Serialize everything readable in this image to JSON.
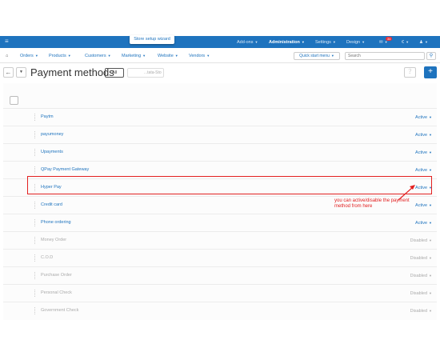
{
  "topbar": {
    "menu_icon": "hamburger-icon",
    "wizard_label": "Store setup wizard",
    "addons": "Add-ons",
    "administration": "Administration",
    "settings": "Settings",
    "design": "Design",
    "notifications_count": "34",
    "currency": "€",
    "user_icon": "user-icon"
  },
  "menubar": {
    "home_icon": "home-icon",
    "items": [
      "Orders",
      "Products",
      "Customers",
      "Marketing",
      "Website",
      "Vendors"
    ],
    "quick_start": "Quick start menu",
    "search_placeholder": "Search",
    "search_icon": "search-icon"
  },
  "titlebar": {
    "back_icon": "arrow-left-icon",
    "title": "Payment methods",
    "all_label": "All",
    "store_filter": "...tata-Sto",
    "help_icon": "help-icon",
    "add_icon": "plus-icon"
  },
  "methods": [
    {
      "name": "Paytm",
      "status": "Active"
    },
    {
      "name": "payumoney",
      "status": "Active"
    },
    {
      "name": "Upayments",
      "status": "Active"
    },
    {
      "name": "QPay Payment Gateway",
      "status": "Active"
    },
    {
      "name": "Hyper Pay",
      "status": "Active"
    },
    {
      "name": "Credit card",
      "status": "Active"
    },
    {
      "name": "Phone ordering",
      "status": "Active"
    },
    {
      "name": "Money Order",
      "status": "Disabled"
    },
    {
      "name": "C.O.D",
      "status": "Disabled"
    },
    {
      "name": "Purchase Order",
      "status": "Disabled"
    },
    {
      "name": "Personal Check",
      "status": "Disabled"
    },
    {
      "name": "Government Check",
      "status": "Disabled"
    }
  ],
  "annotation": {
    "note": "you can active/disable the payment method from here",
    "color": "#e22020"
  },
  "colors": {
    "primary": "#1e73be",
    "disabled": "#aaaaaa"
  }
}
